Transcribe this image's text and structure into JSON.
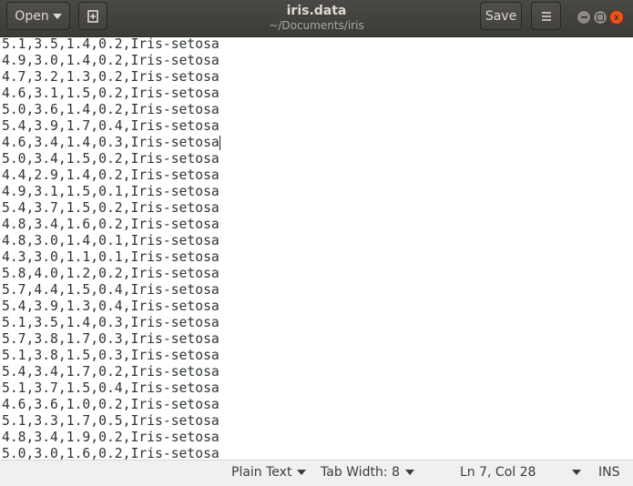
{
  "header": {
    "open_label": "Open",
    "title": "iris.data",
    "subtitle": "~/Documents/iris",
    "save_label": "Save",
    "close_glyph": "x"
  },
  "editor": {
    "lines": [
      "5.1,3.5,1.4,0.2,Iris-setosa",
      "4.9,3.0,1.4,0.2,Iris-setosa",
      "4.7,3.2,1.3,0.2,Iris-setosa",
      "4.6,3.1,1.5,0.2,Iris-setosa",
      "5.0,3.6,1.4,0.2,Iris-setosa",
      "5.4,3.9,1.7,0.4,Iris-setosa",
      "4.6,3.4,1.4,0.3,Iris-setosa",
      "5.0,3.4,1.5,0.2,Iris-setosa",
      "4.4,2.9,1.4,0.2,Iris-setosa",
      "4.9,3.1,1.5,0.1,Iris-setosa",
      "5.4,3.7,1.5,0.2,Iris-setosa",
      "4.8,3.4,1.6,0.2,Iris-setosa",
      "4.8,3.0,1.4,0.1,Iris-setosa",
      "4.3,3.0,1.1,0.1,Iris-setosa",
      "5.8,4.0,1.2,0.2,Iris-setosa",
      "5.7,4.4,1.5,0.4,Iris-setosa",
      "5.4,3.9,1.3,0.4,Iris-setosa",
      "5.1,3.5,1.4,0.3,Iris-setosa",
      "5.7,3.8,1.7,0.3,Iris-setosa",
      "5.1,3.8,1.5,0.3,Iris-setosa",
      "5.4,3.4,1.7,0.2,Iris-setosa",
      "5.1,3.7,1.5,0.4,Iris-setosa",
      "4.6,3.6,1.0,0.2,Iris-setosa",
      "5.1,3.3,1.7,0.5,Iris-setosa",
      "4.8,3.4,1.9,0.2,Iris-setosa",
      "5.0,3.0,1.6,0.2,Iris-setosa"
    ]
  },
  "status": {
    "language": "Plain Text",
    "tab_width": "Tab Width: 8",
    "position": "Ln 7, Col 28",
    "mode": "INS"
  },
  "colors": {
    "close_button": "#e9541f",
    "header_bg": "#3c3b37"
  }
}
